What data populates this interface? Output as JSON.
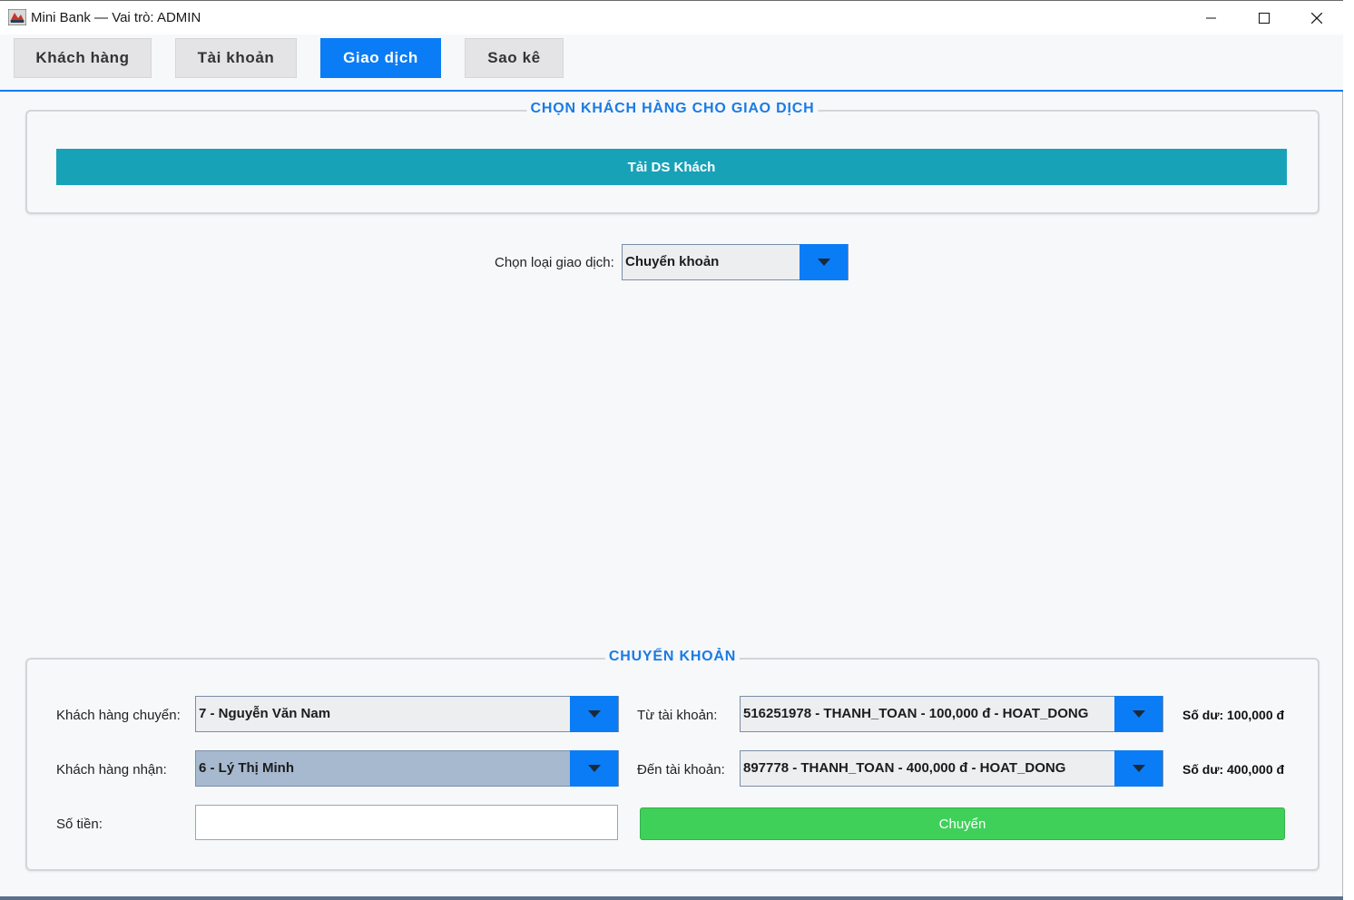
{
  "window": {
    "title": "Mini Bank — Vai trò: ADMIN"
  },
  "tabs": [
    {
      "label": "Khách hàng",
      "active": false
    },
    {
      "label": "Tài khoản",
      "active": false
    },
    {
      "label": "Giao dịch",
      "active": true
    },
    {
      "label": "Sao kê",
      "active": false
    }
  ],
  "customer_panel": {
    "title": "CHỌN KHÁCH HÀNG CHO GIAO DỊCH",
    "load_button": "Tải DS Khách"
  },
  "transaction_type": {
    "label": "Chọn loại giao dịch:",
    "selected": "Chuyển khoản"
  },
  "transfer_panel": {
    "title": "CHUYỂN KHOẢN",
    "sender_label": "Khách hàng chuyển:",
    "sender_value": "7 - Nguyễn Văn Nam",
    "receiver_label": "Khách hàng nhận:",
    "receiver_value": "6 - Lý Thị Minh",
    "amount_label": "Số tiền:",
    "amount_value": "",
    "from_account_label": "Từ tài khoản:",
    "from_account_value": "516251978 - THANH_TOAN - 100,000 đ - HOAT_DONG",
    "to_account_label": "Đến tài khoản:",
    "to_account_value": "897778 - THANH_TOAN - 400,000 đ - HOAT_DONG",
    "from_balance": "Số dư: 100,000 đ",
    "to_balance": "Số dư: 400,000 đ",
    "submit_button": "Chuyển"
  },
  "colors": {
    "accent": "#0a7cf5",
    "load_button": "#17a2b8",
    "submit_button": "#3fd05a",
    "panel_title": "#1a7be4"
  },
  "icons": [
    "app-icon",
    "minimize-icon",
    "maximize-icon",
    "close-icon",
    "chevron-down-icon"
  ]
}
